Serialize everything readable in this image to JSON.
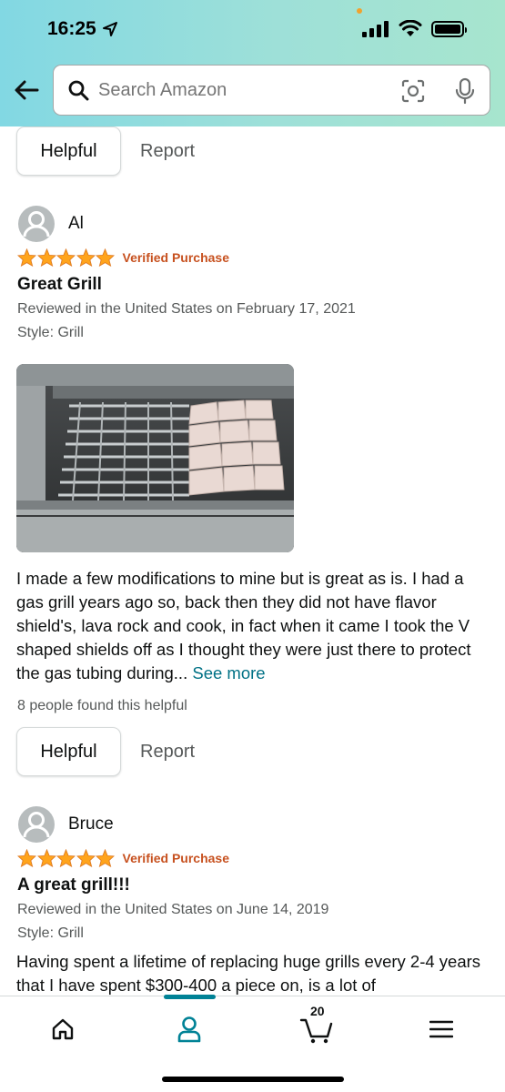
{
  "status_bar": {
    "time": "16:25"
  },
  "search": {
    "placeholder": "Search Amazon"
  },
  "top_actions": {
    "helpful_label": "Helpful",
    "report_label": "Report"
  },
  "reviews": [
    {
      "name": "Al",
      "rating": 5,
      "verified": "Verified Purchase",
      "title": "Great Grill",
      "reviewed": "Reviewed in the United States on February 17, 2021",
      "style": "Style: Grill",
      "body": "I made a few modifications to mine but is great as is. I had a gas grill years ago so, back then they did not have flavor shield's, lava rock and cook, in fact when it came I took the V shaped shields off as I thought they were just there to protect the gas tubing during...",
      "see_more": "See more",
      "helpful_count": "8 people found this helpful",
      "helpful_label": "Helpful",
      "report_label": "Report"
    },
    {
      "name": "Bruce",
      "rating": 5,
      "verified": "Verified Purchase",
      "title": "A great grill!!!",
      "reviewed": "Reviewed in the United States on June 14, 2019",
      "style": "Style: Grill",
      "body": "Having spent a lifetime of replacing huge grills every 2-4 years that I have spent $300-400 a piece on, is a lot of"
    }
  ],
  "bottom_nav": {
    "items": [
      "home-icon",
      "account-icon",
      "cart-icon",
      "menu-icon"
    ],
    "cart_count": "20",
    "active": "account-icon"
  },
  "colors": {
    "accent": "#008296",
    "verified": "#c7511f",
    "link": "#007185",
    "star": "#ffa41c"
  }
}
